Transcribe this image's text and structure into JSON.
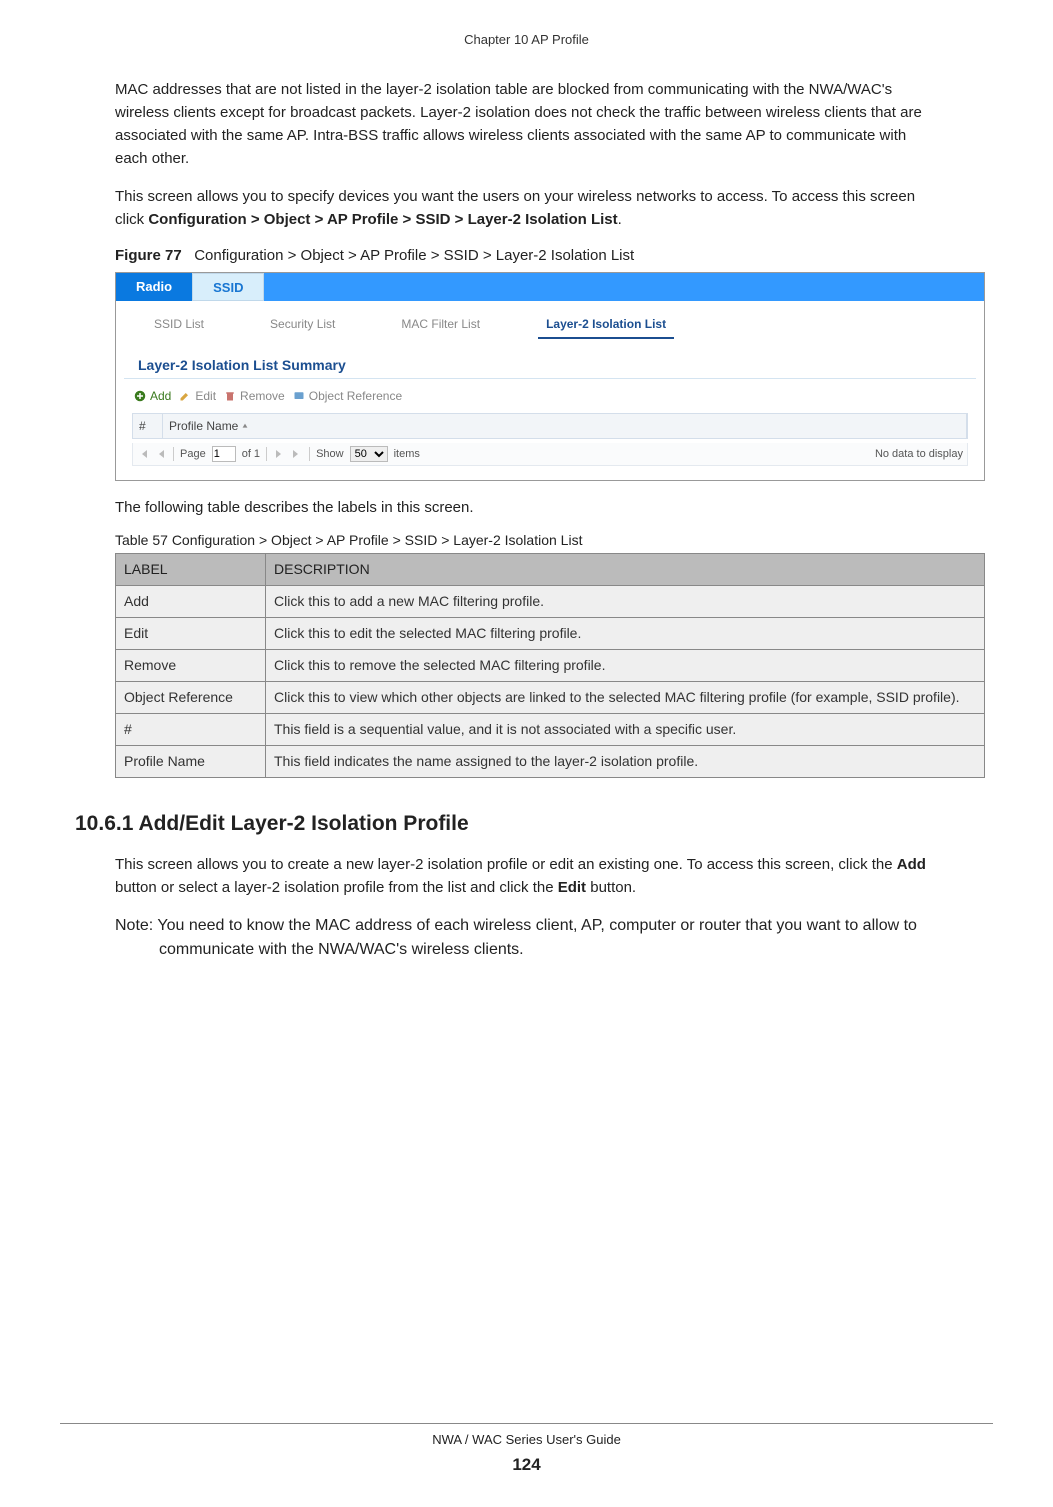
{
  "header": {
    "chapter": "Chapter 10 AP Profile"
  },
  "para1": "MAC addresses that are not listed in the layer-2 isolation table are blocked from communicating with the NWA/WAC's wireless clients except for broadcast packets. Layer-2 isolation does not check the traffic between wireless clients that are associated with the same AP. Intra-BSS traffic allows wireless clients associated with the same AP to communicate with each other.",
  "para2_pre": "This screen allows you to specify devices you want the users on your wireless networks to access. To access this screen click ",
  "para2_bold": "Configuration > Object > AP Profile > SSID > Layer-2 Isolation List",
  "para2_post": ".",
  "figure_label": "Figure 77",
  "figure_caption": "Configuration > Object > AP Profile > SSID > Layer-2 Isolation List",
  "screenshot": {
    "main_tabs": [
      "Radio",
      "SSID"
    ],
    "sub_tabs": [
      "SSID List",
      "Security List",
      "MAC Filter List",
      "Layer-2 Isolation List"
    ],
    "active_sub_tab_index": 3,
    "section_title": "Layer-2 Isolation List Summary",
    "toolbar": {
      "add": "Add",
      "edit": "Edit",
      "remove": "Remove",
      "object_ref": "Object Reference"
    },
    "grid_headers": {
      "hash": "#",
      "profile_name": "Profile Name"
    },
    "pager": {
      "page_label": "Page",
      "page_value": "1",
      "of_label": "of 1",
      "show_label": "Show",
      "show_value": "50",
      "items_label": "items",
      "no_data": "No data to display"
    }
  },
  "table_intro": "The following table describes the labels in this screen.",
  "table_caption": "Table 57   Configuration > Object > AP Profile > SSID > Layer-2 Isolation List",
  "table_headers": {
    "label": "LABEL",
    "description": "DESCRIPTION"
  },
  "table_rows": [
    {
      "label": "Add",
      "desc": "Click this to add a new MAC filtering profile."
    },
    {
      "label": "Edit",
      "desc": "Click this to edit the selected MAC filtering profile."
    },
    {
      "label": "Remove",
      "desc": "Click this to remove the selected MAC filtering profile."
    },
    {
      "label": "Object Reference",
      "desc": "Click this to view which other objects are linked to the selected MAC filtering profile (for example, SSID profile)."
    },
    {
      "label": "#",
      "desc": "This field is a sequential value, and it is not associated with a specific user."
    },
    {
      "label": "Profile Name",
      "desc": "This field indicates the name assigned to the layer-2 isolation profile."
    }
  ],
  "section_heading": "10.6.1  Add/Edit Layer-2 Isolation Profile",
  "sub_para1_pre": "This screen allows you to create a new layer-2 isolation profile or edit an existing one. To access this screen, click the ",
  "sub_para1_bold1": "Add",
  "sub_para1_mid": " button or select a layer-2 isolation profile from the list and click the ",
  "sub_para1_bold2": "Edit",
  "sub_para1_post": " button.",
  "note_text": "Note: You need to know the MAC address of each wireless client, AP, computer or router that you want to allow to communicate with the NWA/WAC's wireless clients.",
  "footer": {
    "guide": "NWA / WAC Series User's Guide",
    "page": "124"
  }
}
